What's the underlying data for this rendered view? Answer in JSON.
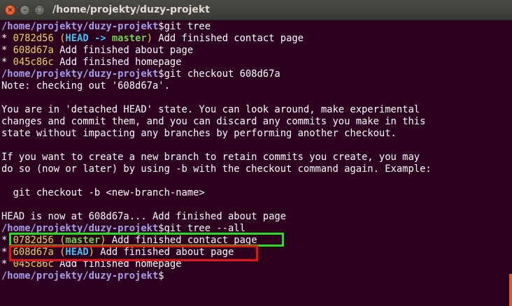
{
  "window": {
    "title": "/home/projekty/duzy-projekt",
    "buttons": {
      "close": "×",
      "minimize": "–",
      "maximize": "□"
    }
  },
  "terminal": {
    "prompt": "/home/projekty/duzy-projekt",
    "cmd1": "$git tree",
    "l1": {
      "star": "* ",
      "hash": "0782d56",
      "p_open": " (",
      "head": "HEAD -> ",
      "branch": "master",
      "p_close": ")",
      "msg": " Add finished contact page"
    },
    "l2": {
      "star": "* ",
      "hash": "608d67a",
      "msg": " Add finished about page"
    },
    "l3": {
      "star": "* ",
      "hash": "045c86c",
      "msg": " Add finished homepage"
    },
    "cmd2": "$git checkout 608d67a",
    "note": "Note: checking out '608d67a'.",
    "detached1": "You are in 'detached HEAD' state. You can look around, make experimental",
    "detached2": "changes and commit them, and you can discard any commits you make in this",
    "detached3": "state without impacting any branches by performing another checkout.",
    "branch1": "If you want to create a new branch to retain commits you create, you may",
    "branch2": "do so (now or later) by using -b with the checkout command again. Example:",
    "example": "  git checkout -b <new-branch-name>",
    "head_now": "HEAD is now at 608d67a... Add finished about page",
    "cmd3": "$git tree --all",
    "l4": {
      "star": "* ",
      "hash": "0782d56",
      "p_open": " (",
      "branch": "master",
      "p_close": ")",
      "msg": " Add finished contact page"
    },
    "l5": {
      "star": "* ",
      "hash": "608d67a",
      "p_open": " (",
      "head": "HEAD",
      "p_close": ")",
      "msg": " Add finished about page"
    },
    "l6": {
      "star": "* ",
      "hash": "045c86c",
      "msg": " Add finished homepage"
    },
    "cmd4": "$"
  },
  "colors": {
    "background": "#2c001e",
    "prompt": "#a59ee8",
    "hash": "#e6d94a",
    "head": "#3fc4ee",
    "branch": "#6ed143",
    "highlight_green": "#22e01a",
    "highlight_red": "#e8111a"
  }
}
